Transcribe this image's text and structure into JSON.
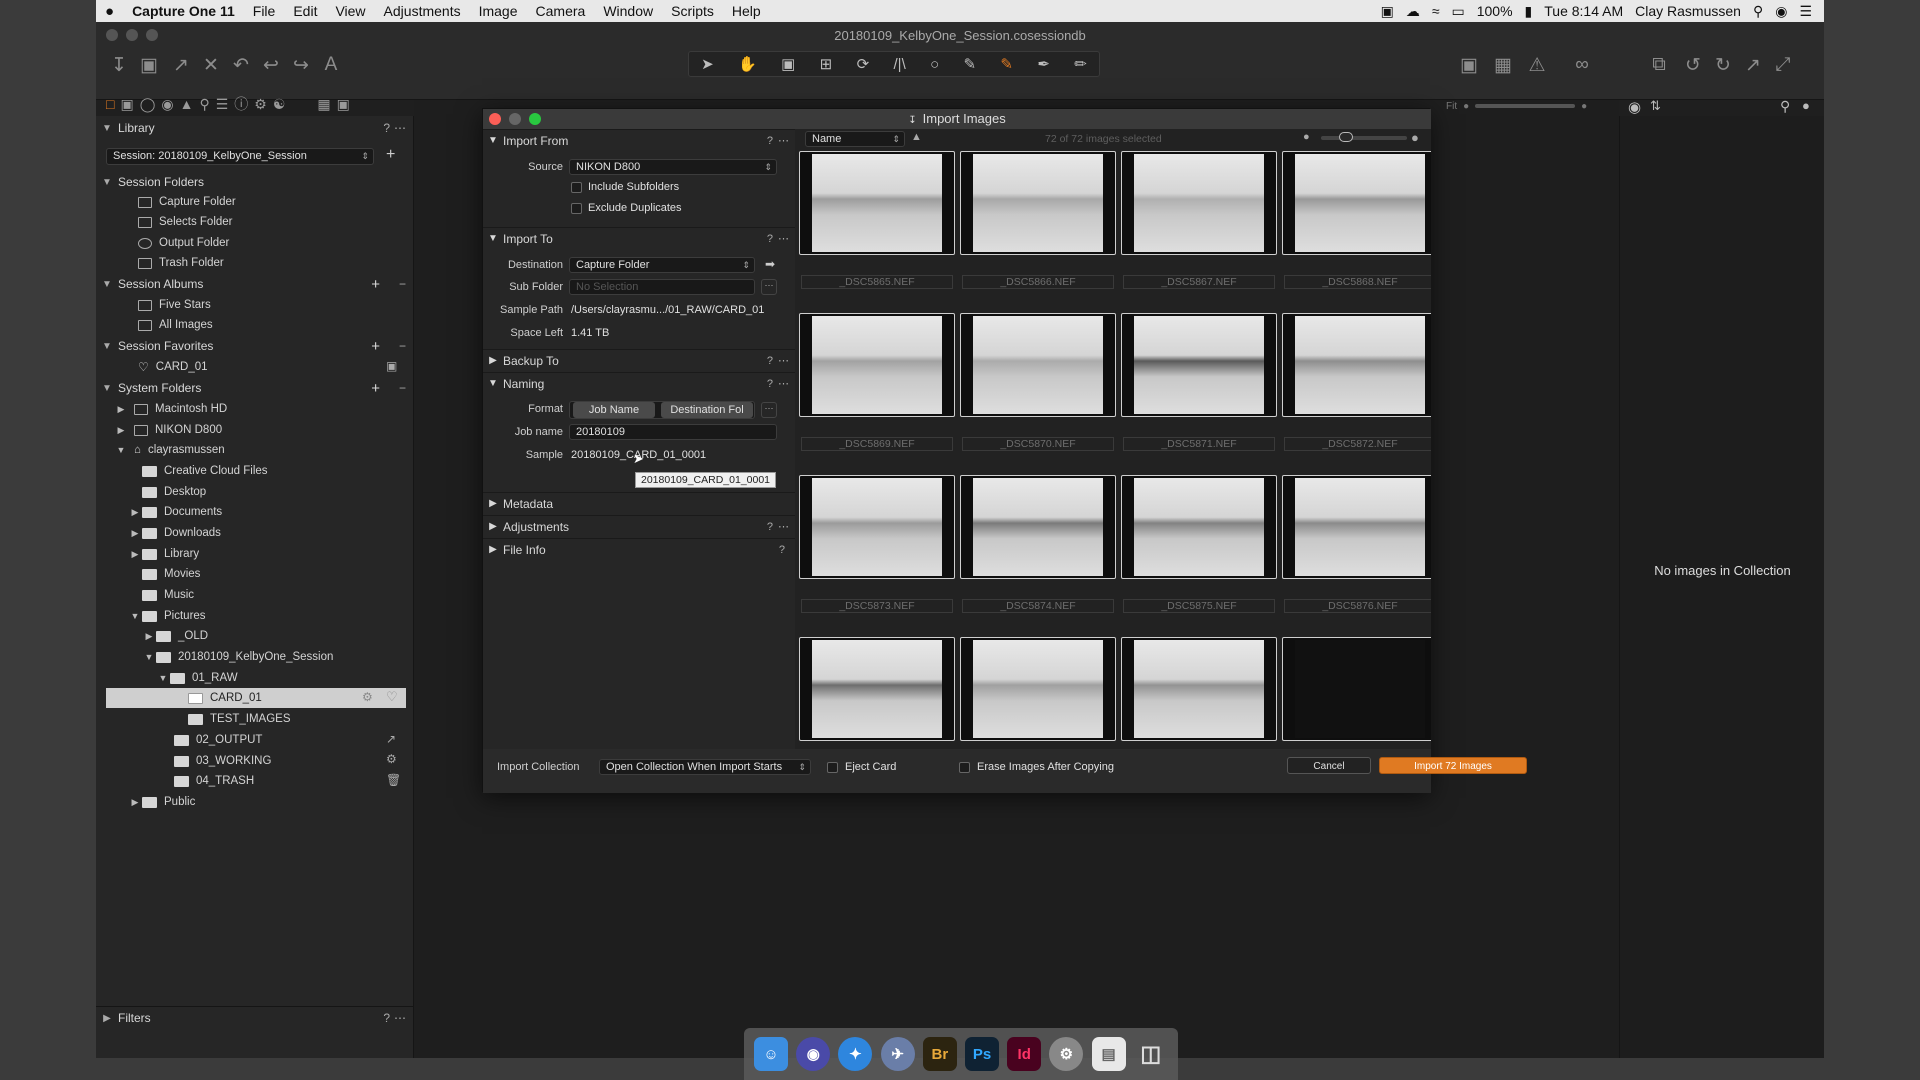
{
  "menubar": {
    "apple": "",
    "app": "Capture One 11",
    "items": [
      "File",
      "Edit",
      "View",
      "Adjustments",
      "Image",
      "Camera",
      "Window",
      "Scripts",
      "Help"
    ],
    "battery": "100%",
    "clock": "Tue 8:14 AM",
    "user": "Clay Rasmussen"
  },
  "window": {
    "title": "20180109_KelbyOne_Session.cosessiondb"
  },
  "library": {
    "title": "Library",
    "help": "?",
    "session_select": "Session: 20180109_KelbyOne_Session",
    "session_folders": {
      "title": "Session Folders",
      "items": [
        "Capture Folder",
        "Selects Folder",
        "Output Folder",
        "Trash Folder"
      ]
    },
    "session_albums": {
      "title": "Session Albums",
      "items": [
        "Five Stars",
        "All Images"
      ]
    },
    "session_favorites": {
      "title": "Session Favorites",
      "items": [
        "CARD_01"
      ]
    },
    "system_folders": {
      "title": "System Folders",
      "items": [
        "Macintosh HD",
        "NIKON D800",
        "clayrasmussen",
        "Creative Cloud Files",
        "Desktop",
        "Documents",
        "Downloads",
        "Library",
        "Movies",
        "Music",
        "Pictures",
        "_OLD",
        "20180109_KelbyOne_Session",
        "01_RAW",
        "CARD_01",
        "TEST_IMAGES",
        "02_OUTPUT",
        "03_WORKING",
        "04_TRASH",
        "Public"
      ]
    },
    "filters": "Filters"
  },
  "dialog": {
    "title": "Import Images",
    "import_from": {
      "title": "Import From",
      "source_label": "Source",
      "source_value": "NIKON D800",
      "include_subfolders": "Include Subfolders",
      "exclude_duplicates": "Exclude Duplicates"
    },
    "import_to": {
      "title": "Import To",
      "destination_label": "Destination",
      "destination_value": "Capture Folder",
      "subfolder_label": "Sub Folder",
      "subfolder_placeholder": "No Selection",
      "sample_path_label": "Sample Path",
      "sample_path_value": "/Users/clayrasmu.../01_RAW/CARD_01",
      "space_left_label": "Space Left",
      "space_left_value": "1.41 TB"
    },
    "backup_to": {
      "title": "Backup To"
    },
    "naming": {
      "title": "Naming",
      "format_label": "Format",
      "token1": "Job Name",
      "token2": "Destination Fol",
      "jobname_label": "Job name",
      "jobname_value": "20180109",
      "sample_label": "Sample",
      "sample_value": "20180109_CARD_01_0001",
      "tooltip": "20180109_CARD_01_0001"
    },
    "metadata": {
      "title": "Metadata"
    },
    "adjustments": {
      "title": "Adjustments"
    },
    "file_info": {
      "title": "File Info"
    },
    "sort": {
      "value": "Name"
    },
    "selected_count": "72 of 72 images selected",
    "thumbnails": [
      "_DSC5865.NEF",
      "_DSC5866.NEF",
      "_DSC5867.NEF",
      "_DSC5868.NEF",
      "_DSC5869.NEF",
      "_DSC5870.NEF",
      "_DSC5871.NEF",
      "_DSC5872.NEF",
      "_DSC5873.NEF",
      "_DSC5874.NEF",
      "_DSC5875.NEF",
      "_DSC5876.NEF",
      "",
      "",
      "",
      ""
    ],
    "bottom": {
      "import_collection_label": "Import Collection",
      "import_collection_value": "Open Collection When Import Starts",
      "eject_card": "Eject Card",
      "erase_images": "Erase Images After Copying",
      "cancel": "Cancel",
      "import": "Import 72 Images"
    }
  },
  "viewer": {
    "empty_message": "No images in Collection",
    "fit": "Fit"
  },
  "dock": {
    "items": [
      "Finder",
      "Siri",
      "Safari",
      "Launchpad",
      "Br",
      "Ps",
      "Id",
      "Preferences",
      "Documents",
      "Trash"
    ]
  },
  "colors": {
    "accent": "#e07a22",
    "window_bg": "#1f1f1f",
    "panel_bg": "#262626"
  }
}
